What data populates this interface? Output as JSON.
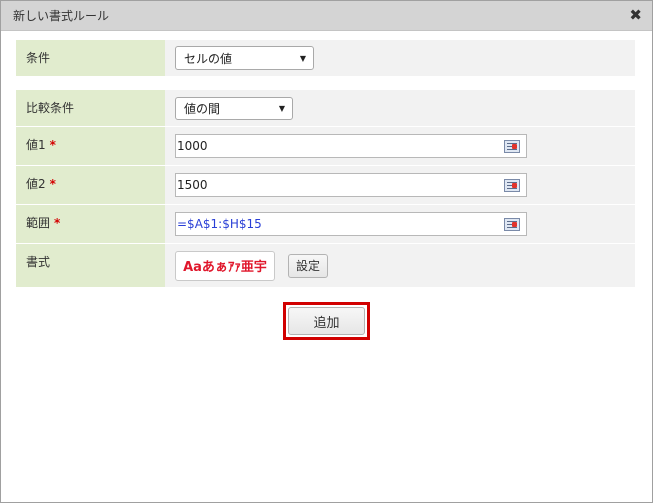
{
  "dialog": {
    "title": "新しい書式ルール",
    "close_glyph": "✖"
  },
  "condition": {
    "label": "条件",
    "value": "セルの値"
  },
  "comparison": {
    "label": "比較条件",
    "value": "値の間"
  },
  "value1": {
    "label": "値1",
    "required_mark": "*",
    "value": "1000"
  },
  "value2": {
    "label": "値2",
    "required_mark": "*",
    "value": "1500"
  },
  "range": {
    "label": "範囲",
    "required_mark": "*",
    "value": "=$A$1:$H$15"
  },
  "format": {
    "label": "書式",
    "preview_text": "Aaあぁｱｧ亜宇",
    "preview_color": "#e0162b",
    "settings_label": "設定"
  },
  "add_button": {
    "label": "追加",
    "highlight_color": "#d10000"
  },
  "icons": {
    "close": "close-icon",
    "dropdown": "chevron-down-icon",
    "range_picker": "range-picker-icon"
  },
  "colors": {
    "title_bar": "#d4d4d4",
    "label_bg": "#e1ecce",
    "row_bg": "#f2f2f2",
    "required": "#d40000",
    "range_text": "#2a3fd6"
  }
}
